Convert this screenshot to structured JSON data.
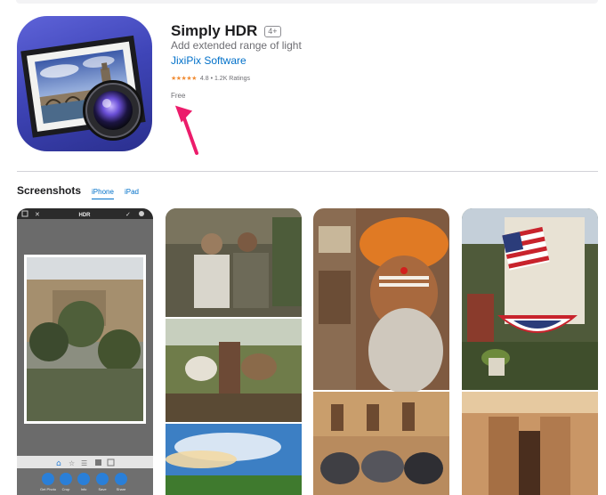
{
  "app": {
    "title": "Simply HDR",
    "age_rating": "4+",
    "subtitle": "Add extended range of light",
    "developer": "JixiPix Software",
    "stars": "★★★★★",
    "rating_text": "4.8 • 1.2K Ratings",
    "price": "Free"
  },
  "screenshots": {
    "title": "Screenshots",
    "tabs": [
      {
        "label": "iPhone",
        "active": true
      },
      {
        "label": "iPad",
        "active": false
      }
    ],
    "items": [
      {
        "name": "app-ui-screenshot"
      },
      {
        "name": "collage-people-oxen-sky"
      },
      {
        "name": "collage-sadhu-scooters"
      },
      {
        "name": "collage-flag-house-ruins"
      }
    ],
    "phone_ui": {
      "header_label": "HDR",
      "toolbar_labels": [
        "Get Photo",
        "Crop",
        "Info",
        "Save",
        "Share"
      ]
    }
  },
  "colors": {
    "link_blue": "#0070c9",
    "star_orange": "#f18d35",
    "arrow_pink": "#ec1c6b"
  }
}
